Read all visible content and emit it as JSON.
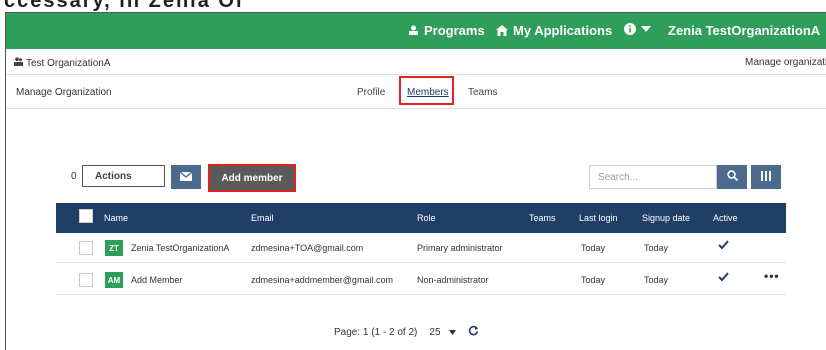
{
  "top_cut_text": "ccessary, in Zenia Ol",
  "navbar": {
    "programs": "Programs",
    "my_applications": "My Applications",
    "user": "Zenia TestOrganizationA"
  },
  "org": {
    "name": "Test OrganizationA",
    "manage_link": "Manage organizati"
  },
  "manage": {
    "title": "Manage Organization",
    "tabs": [
      {
        "label": "Profile"
      },
      {
        "label": "Members"
      },
      {
        "label": "Teams"
      }
    ]
  },
  "toolbar": {
    "count": "0",
    "actions_label": "Actions",
    "add_member_label": "Add member",
    "search_placeholder": "Search..."
  },
  "table": {
    "columns": [
      "Name",
      "Email",
      "Role",
      "Teams",
      "Last login",
      "Signup date",
      "Active"
    ],
    "rows": [
      {
        "initials": "ZT",
        "name": "Zenia TestOrganizationA",
        "email": "zdmesina+TOA@gmail.com",
        "role": "Primary administrator",
        "teams": "",
        "last_login": "Today",
        "signup": "Today",
        "active": true,
        "more": ""
      },
      {
        "initials": "AM",
        "name": "Add Member",
        "email": "zdmesina+addmember@gmail.com",
        "role": "Non-administrator",
        "teams": "",
        "last_login": "Today",
        "signup": "Today",
        "active": true,
        "more": "•••"
      }
    ]
  },
  "pager": {
    "label": "Page: 1  (1 - 2 of 2)",
    "page_size": "25"
  },
  "colors": {
    "nav_green": "#2e9e5a",
    "header_navy": "#1f3f66",
    "button_slate": "#4b6a8c",
    "highlight_red": "#e02424"
  }
}
